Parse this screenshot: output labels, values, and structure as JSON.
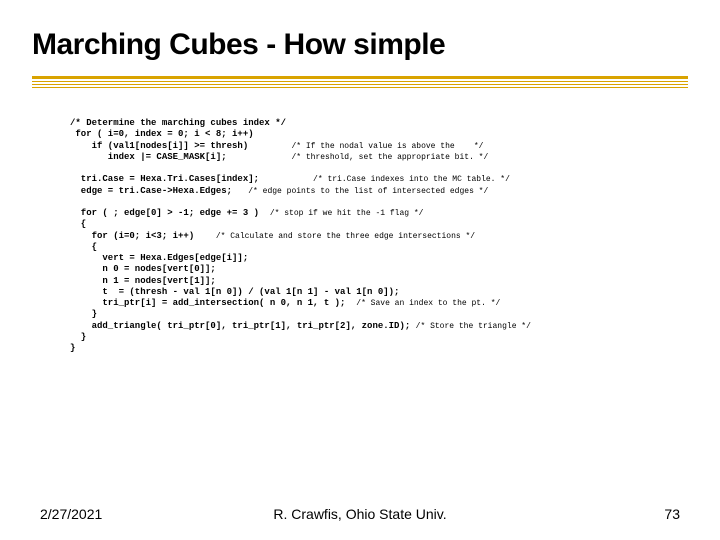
{
  "title": "Marching Cubes - How simple",
  "code": {
    "l1": "/* Determine the marching cubes index */",
    "l2": " for ( i=0, index = 0; i < 8; i++)",
    "l3a": "    if (val1[nodes[i]] >= thresh)",
    "l3c": "/* If the nodal value is above the    */",
    "l4a": "       index |= CASE_MASK[i];",
    "l4c": "/* threshold, set the appropriate bit. */",
    "l5a": "  tri.Case = Hexa.Tri.Cases[index];",
    "l5c": "/* tri.Case indexes into the MC table. */",
    "l6a": "  edge = tri.Case->Hexa.Edges;",
    "l6c": "/* edge points to the list of intersected edges */",
    "l7a": "  for ( ; edge[0] > -1; edge += 3 )",
    "l7c": "/* stop if we hit the -1 flag */",
    "l8": "  {",
    "l9a": "    for (i=0; i<3; i++)",
    "l9c": "/* Calculate and store the three edge intersections */",
    "l10": "    {",
    "l11": "      vert = Hexa.Edges[edge[i]];",
    "l12": "      n 0 = nodes[vert[0]];",
    "l13": "      n 1 = nodes[vert[1]];",
    "l14": "      t  = (thresh - val 1[n 0]) / (val 1[n 1] - val 1[n 0]);",
    "l15a": "      tri_ptr[i] = add_intersection( n 0, n 1, t );",
    "l15c": "/* Save an index to the pt. */",
    "l16": "    }",
    "l17a": "    add_triangle( tri_ptr[0], tri_ptr[1], tri_ptr[2], zone.ID);",
    "l17c": "/* Store the triangle */",
    "l18": "  }",
    "l19": "}"
  },
  "footer": {
    "date": "2/27/2021",
    "author": "R. Crawfis, Ohio State Univ.",
    "page": "73"
  }
}
